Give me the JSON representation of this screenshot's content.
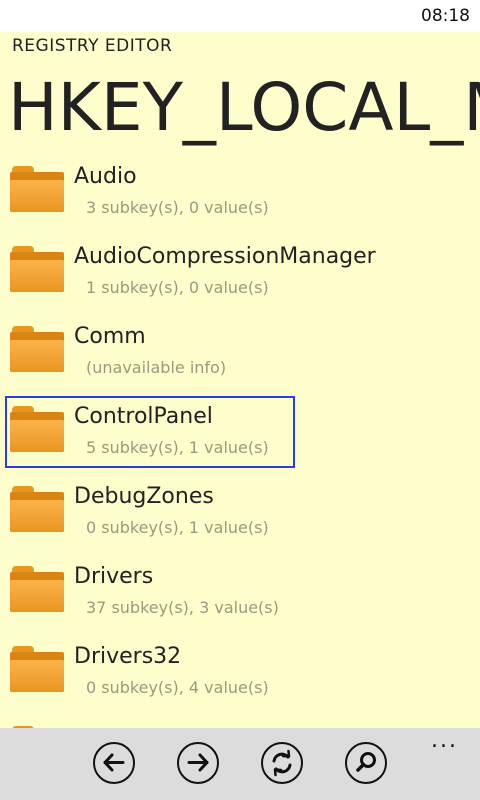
{
  "status_bar": {
    "time": "08:18"
  },
  "header": {
    "app_title": "REGISTRY EDITOR",
    "page_title": "HKEY_LOCAL_MACHINE"
  },
  "keys": [
    {
      "name": "Audio",
      "info": "3 subkey(s), 0 value(s)"
    },
    {
      "name": "AudioCompressionManager",
      "info": "1 subkey(s), 0 value(s)"
    },
    {
      "name": "Comm",
      "info": "(unavailable info)"
    },
    {
      "name": "ControlPanel",
      "info": "5 subkey(s), 1 value(s)",
      "selected": true
    },
    {
      "name": "DebugZones",
      "info": "0 subkey(s), 1 value(s)"
    },
    {
      "name": "Drivers",
      "info": "37 subkey(s), 3 value(s)"
    },
    {
      "name": "Drivers32",
      "info": "0 subkey(s), 4 value(s)"
    }
  ],
  "app_bar": {
    "buttons": [
      {
        "icon": "back-arrow-icon"
      },
      {
        "icon": "forward-arrow-icon"
      },
      {
        "icon": "refresh-icon"
      },
      {
        "icon": "search-icon"
      }
    ],
    "more": "..."
  },
  "colors": {
    "background": "#fefecd",
    "app_bar": "#dcdcdc",
    "selection_border": "#2b3fe0",
    "folder": "#f0a030",
    "secondary_text": "#9a9a80"
  }
}
